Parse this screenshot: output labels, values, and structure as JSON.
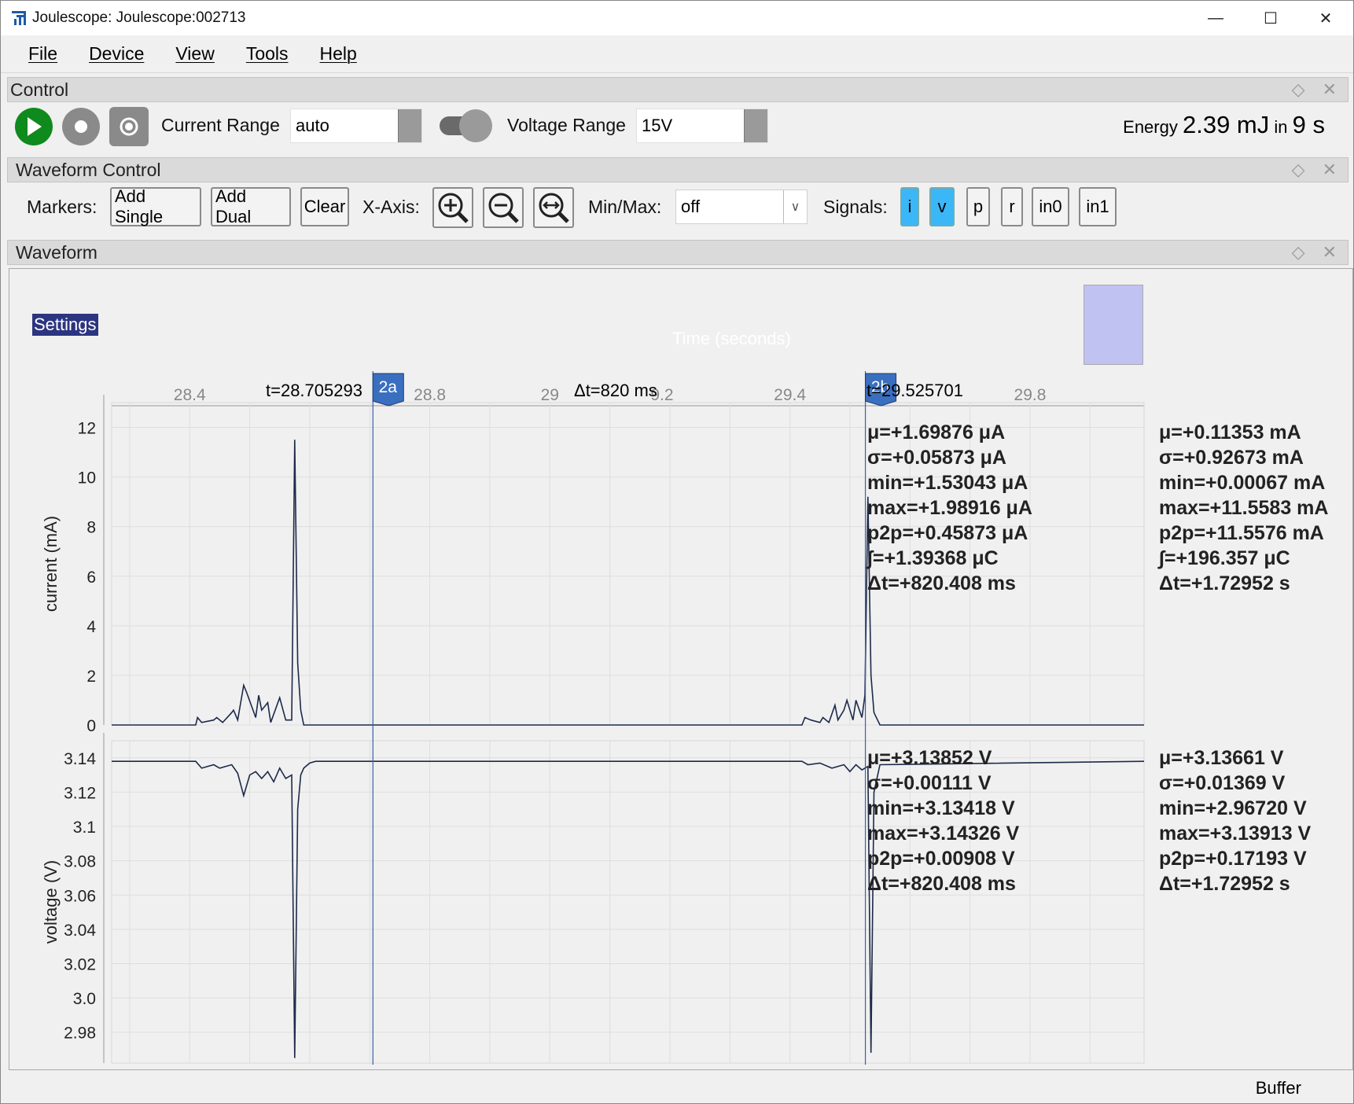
{
  "window": {
    "title": "Joulescope: Joulescope:002713",
    "minimize": "—",
    "maximize": "☐",
    "close": "✕"
  },
  "menu": [
    "File",
    "Device",
    "View",
    "Tools",
    "Help"
  ],
  "control": {
    "header": "Control",
    "current_range_label": "Current Range",
    "current_range_value": "auto",
    "voltage_range_label": "Voltage Range",
    "voltage_range_value": "15V",
    "energy_label": "Energy",
    "energy_value": "2.39 mJ",
    "energy_in": "in",
    "energy_time": "9 s"
  },
  "waveform_control": {
    "header": "Waveform Control",
    "markers_label": "Markers:",
    "add_single": "Add Single",
    "add_dual": "Add Dual",
    "clear": "Clear",
    "xaxis_label": "X-Axis:",
    "minmax_label": "Min/Max:",
    "minmax_value": "off",
    "signals_label": "Signals:",
    "signals": [
      {
        "label": "i",
        "selected": true
      },
      {
        "label": "v",
        "selected": true
      },
      {
        "label": "p",
        "selected": false
      },
      {
        "label": "r",
        "selected": false
      },
      {
        "label": "in0",
        "selected": false
      },
      {
        "label": "in1",
        "selected": false
      }
    ]
  },
  "waveform": {
    "header": "Waveform",
    "settings": "Settings",
    "time_axis_label": "Time (seconds)",
    "marker_a": "2a",
    "marker_b": "2b",
    "marker_a_time": "t=28.705293",
    "marker_b_time": "t=29.525701",
    "delta_t": "Δt=820 ms",
    "current_stats_marker": [
      "μ=+1.69876 μA",
      "σ=+0.05873 μA",
      "min=+1.53043 μA",
      "max=+1.98916 μA",
      "p2p=+0.45873 μA",
      "∫=+1.39368 μC",
      "Δt=+820.408 ms"
    ],
    "current_stats_total": [
      "μ=+0.11353 mA",
      "σ=+0.92673 mA",
      "min=+0.00067 mA",
      "max=+11.5583 mA",
      "p2p=+11.5576 mA",
      "∫=+196.357 μC",
      "Δt=+1.72952 s"
    ],
    "voltage_stats_marker": [
      "μ=+3.13852 V",
      "σ=+0.00111 V",
      "min=+3.13418 V",
      "max=+3.14326 V",
      "p2p=+0.00908 V",
      "Δt=+820.408 ms"
    ],
    "voltage_stats_total": [
      "μ=+3.13661 V",
      "σ=+0.01369 V",
      "min=+2.96720 V",
      "max=+3.13913 V",
      "p2p=+0.17193 V",
      "Δt=+1.72952 s"
    ]
  },
  "status": {
    "buffer": "Buffer"
  },
  "chart_data": [
    {
      "type": "line",
      "ylabel": "current (mA)",
      "xlabel": "Time (seconds)",
      "xlim": [
        28.27,
        29.99
      ],
      "ylim": [
        0,
        13
      ],
      "x_ticks": [
        "28.4",
        "28.8",
        "29",
        "9.2",
        "29.4",
        "29.8"
      ],
      "y_ticks": [
        "0",
        "2",
        "4",
        "6",
        "8",
        "10",
        "12"
      ],
      "series": [
        {
          "x": [
            28.27,
            28.41,
            28.413,
            28.42,
            28.44,
            28.445,
            28.455,
            28.47,
            28.473,
            28.48,
            28.49,
            28.495,
            28.51,
            28.515,
            28.52,
            28.53,
            28.535,
            28.55,
            28.56,
            28.57,
            28.575,
            28.58,
            28.585,
            28.59,
            28.6,
            28.61,
            29.42,
            29.425,
            29.435,
            29.45,
            29.455,
            29.465,
            29.475,
            29.48,
            29.49,
            29.495,
            29.505,
            29.51,
            29.52,
            29.525,
            29.53,
            29.535,
            29.54,
            29.55,
            29.99
          ],
          "y": [
            0,
            0,
            0.3,
            0.1,
            0.2,
            0.3,
            0.1,
            0.5,
            0.6,
            0.2,
            1.6,
            1.3,
            0.3,
            1.2,
            0.6,
            0.9,
            0.1,
            1.1,
            0.2,
            0.2,
            11.5,
            2.5,
            0.6,
            0,
            0,
            0,
            0,
            0.3,
            0.2,
            0.1,
            0.3,
            0.1,
            0.8,
            0.2,
            0.6,
            1.0,
            0.2,
            1.0,
            0.3,
            1.2,
            9.2,
            2.0,
            0.5,
            0,
            0
          ]
        }
      ]
    },
    {
      "type": "line",
      "ylabel": "voltage (V)",
      "xlim": [
        28.27,
        29.99
      ],
      "ylim": [
        2.962,
        3.15
      ],
      "y_ticks": [
        "2.98",
        "3.0",
        "3.02",
        "3.04",
        "3.06",
        "3.08",
        "3.1",
        "3.12",
        "3.14"
      ],
      "series": [
        {
          "x": [
            28.27,
            28.41,
            28.42,
            28.44,
            28.45,
            28.47,
            28.48,
            28.49,
            28.5,
            28.51,
            28.52,
            28.53,
            28.54,
            28.55,
            28.56,
            28.57,
            28.575,
            28.58,
            28.585,
            28.59,
            28.6,
            28.61,
            29.42,
            29.43,
            29.45,
            29.47,
            29.49,
            29.5,
            29.51,
            29.52,
            29.53,
            29.535,
            29.54,
            29.55,
            29.99
          ],
          "y": [
            3.138,
            3.138,
            3.134,
            3.136,
            3.134,
            3.136,
            3.131,
            3.118,
            3.13,
            3.132,
            3.128,
            3.132,
            3.126,
            3.134,
            3.128,
            3.13,
            2.965,
            3.11,
            3.13,
            3.134,
            3.137,
            3.138,
            3.138,
            3.136,
            3.137,
            3.134,
            3.136,
            3.132,
            3.136,
            3.133,
            3.135,
            2.968,
            3.12,
            3.136,
            3.138
          ]
        }
      ]
    }
  ]
}
